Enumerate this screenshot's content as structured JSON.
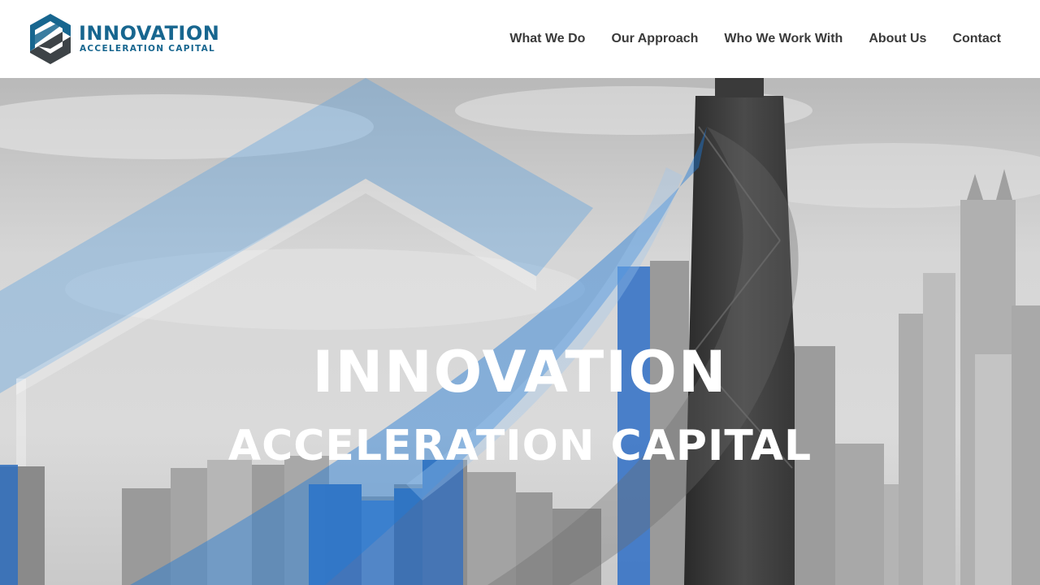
{
  "brand": {
    "logo_line1": "INNOVATION",
    "logo_line2": "ACCELERATION  CAPITAL",
    "primary_color": "#17668f",
    "secondary_color": "#3d4347",
    "accent_blue": "#1f7ad6"
  },
  "nav": {
    "items": [
      {
        "label": "What We Do"
      },
      {
        "label": "Our Approach"
      },
      {
        "label": "Who We Work With"
      },
      {
        "label": "About Us"
      },
      {
        "label": "Contact"
      }
    ]
  },
  "hero": {
    "title_line1": "INNOVATION",
    "title_line2": "ACCELERATION CAPITAL",
    "background": "grayscale city skyline with blue chevron overlay"
  }
}
